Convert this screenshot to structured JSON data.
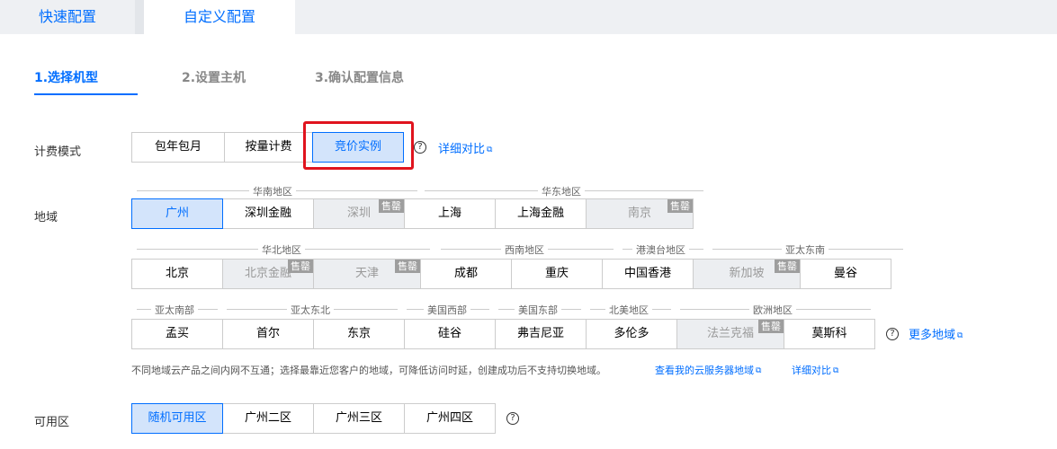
{
  "top_tabs": {
    "quick": "快速配置",
    "custom": "自定义配置"
  },
  "steps": [
    "1.选择机型",
    "2.设置主机",
    "3.确认配置信息"
  ],
  "billing": {
    "label": "计费模式",
    "options": [
      "包年包月",
      "按量计费",
      "竞价实例"
    ],
    "selected": "竞价实例",
    "compare_link": "详细对比"
  },
  "region": {
    "label": "地域",
    "sold_out_badge": "售罄",
    "groups": [
      "华南地区",
      "华东地区",
      "华北地区",
      "西南地区",
      "港澳台地区",
      "亚太东南",
      "亚太南部",
      "亚太东北",
      "美国西部",
      "美国东部",
      "北美地区",
      "欧洲地区"
    ],
    "row1": [
      "广州",
      "深圳金融",
      "深圳",
      "上海",
      "上海金融",
      "南京"
    ],
    "row2": [
      "北京",
      "北京金融",
      "天津",
      "成都",
      "重庆",
      "中国香港",
      "新加坡",
      "曼谷"
    ],
    "row3": [
      "孟买",
      "首尔",
      "东京",
      "硅谷",
      "弗吉尼亚",
      "多伦多",
      "法兰克福",
      "莫斯科"
    ],
    "selected": "广州",
    "sold_out": [
      "深圳",
      "南京",
      "北京金融",
      "天津",
      "新加坡",
      "法兰克福"
    ],
    "more_link": "更多地域",
    "note": "不同地域云产品之间内网不互通；选择最靠近您客户的地域，可降低访问时延，创建成功后不支持切换地域。",
    "view_link": "查看我的云服务器地域",
    "compare_link": "详细对比"
  },
  "zone": {
    "label": "可用区",
    "options": [
      "随机可用区",
      "广州二区",
      "广州三区",
      "广州四区"
    ],
    "selected": "随机可用区"
  }
}
